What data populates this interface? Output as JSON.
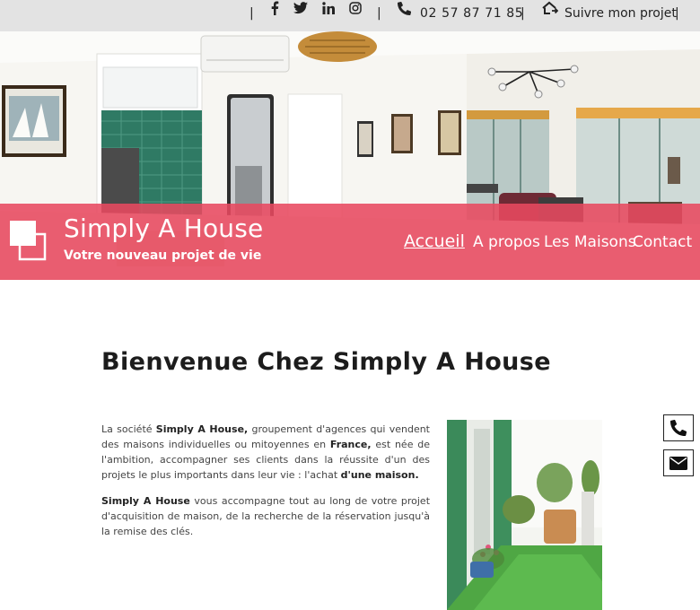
{
  "topbar": {
    "phone": "02 57 87 71 85",
    "follow_label": "Suivre mon projet",
    "social": [
      "facebook-icon",
      "twitter-icon",
      "linkedin-icon",
      "instagram-icon"
    ]
  },
  "header": {
    "brand_name": "Simply A House",
    "tagline": "Votre nouveau projet de vie",
    "nav": [
      {
        "label": "Accueil",
        "active": true
      },
      {
        "label": "A propos",
        "active": false
      },
      {
        "label": "Les Maisons",
        "active": false
      },
      {
        "label": "Contact",
        "active": false
      }
    ]
  },
  "main": {
    "title": "Bienvenue Chez Simply A House",
    "p1": {
      "t1": "La société ",
      "b1": "Simply A House,",
      "t2": " groupement d'agences qui vendent des maisons individuelles ou mitoyennes en ",
      "b2": "France,",
      "t3": " est née de l'ambition, accompagner ses clients dans la réussite d'un des projets le plus importants dans leur vie : l'achat ",
      "b3": "d'une maison."
    },
    "p2": {
      "b1": "Simply A House",
      "t1": " vous accompagne tout au long de votre projet d'acquisition de maison, de la recherche de la réservation jusqu'à la remise des clés."
    }
  },
  "colors": {
    "accent": "#e84960",
    "topbar": "#e3e3e3"
  }
}
